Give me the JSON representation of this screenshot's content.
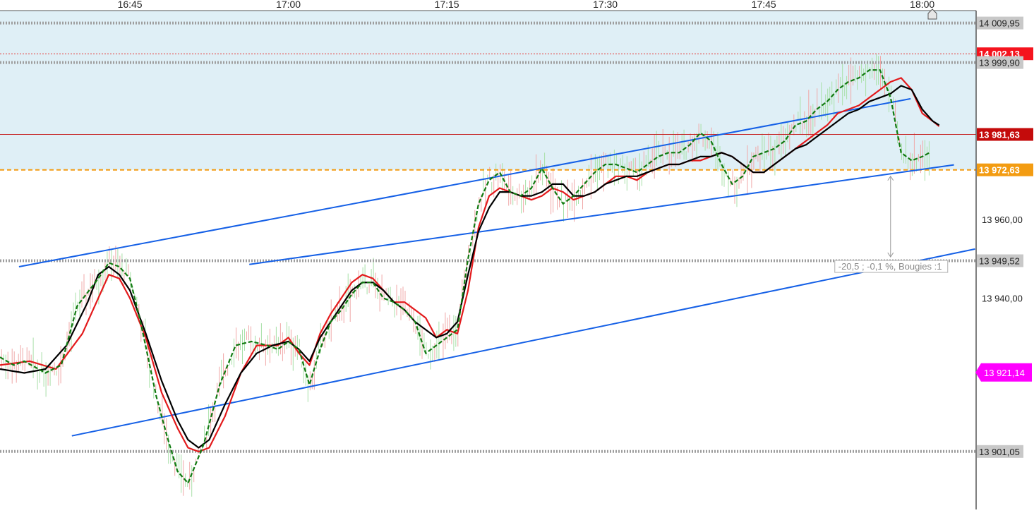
{
  "chart_data": {
    "type": "candlestick",
    "title": "",
    "xaxis": {
      "ticks": [
        "16:45",
        "17:00",
        "17:15",
        "17:30",
        "17:45",
        "18:00"
      ],
      "tick_minutes": [
        0,
        15,
        30,
        45,
        60,
        75
      ],
      "range_minutes": [
        -12.3,
        80.1
      ]
    },
    "yaxis": {
      "ticks": [
        "13 960,00",
        "13 940,00"
      ],
      "tick_values": [
        13960,
        13940
      ],
      "obscured_ticks": [
        13980,
        13920,
        13900
      ],
      "ylim": [
        13886.3,
        14015.8
      ],
      "side": "right"
    },
    "horizontal_levels": [
      {
        "label": "14 009,95",
        "value": 14009.95,
        "style": "dotted",
        "color": "#9e9e9e",
        "badge": "#c8c8c8"
      },
      {
        "label": "14 002,13",
        "value": 14002.13,
        "style": "dotted",
        "color": "#e53935",
        "badge": "#f5141e"
      },
      {
        "label": "13 999,90",
        "value": 13999.9,
        "style": "dotted",
        "color": "#9e9e9e",
        "badge": "#c8c8c8"
      },
      {
        "label": "13 981,63",
        "value": 13981.63,
        "style": "solid",
        "color": "#c62828",
        "badge": "#c40b0b"
      },
      {
        "label": "13 972,63",
        "value": 13972.63,
        "style": "dashed",
        "color": "#f39c12",
        "badge": "#f39c12"
      },
      {
        "label": "13 949,52",
        "value": 13949.52,
        "style": "dotted",
        "color": "#9e9e9e",
        "badge": "#c8c8c8"
      },
      {
        "label": "13 901,05",
        "value": 13901.05,
        "style": "dotted",
        "color": "#9e9e9e",
        "badge": "#c8c8c8"
      }
    ],
    "last_price": {
      "label": "13 921,14",
      "value": 13921.14,
      "color": "#ff00ff"
    },
    "shaded_zone": {
      "from": 13972.63,
      "to": 14015.8,
      "color": "#dfeff6"
    },
    "trendlines": [
      {
        "name": "upper",
        "start": [
          -10.5,
          13948.0
        ],
        "end": [
          73.9,
          13990.7
        ]
      },
      {
        "name": "middle",
        "start": [
          11.3,
          13948.6
        ],
        "end": [
          78.0,
          13973.9
        ]
      },
      {
        "name": "lower",
        "start": [
          -5.5,
          13905.0
        ],
        "end": [
          80.0,
          13952.5
        ]
      }
    ],
    "measure": {
      "label": "-20,5 ; -0,1 %, Bougies :1",
      "x_minutes": 72.0,
      "from": 13971.0,
      "to": 13950.5
    },
    "series": [
      {
        "name": "",
        "color": "#e31a1c",
        "points": [
          [
            -12.3,
            13923
          ],
          [
            -9.5,
            13924
          ],
          [
            -7,
            13922
          ],
          [
            -4.5,
            13931
          ],
          [
            -2,
            13946
          ],
          [
            -1,
            13945
          ],
          [
            0,
            13940
          ],
          [
            1.5,
            13930
          ],
          [
            3,
            13916
          ],
          [
            4.5,
            13907
          ],
          [
            5.5,
            13902
          ],
          [
            6.5,
            13901
          ],
          [
            7.5,
            13902
          ],
          [
            9,
            13910
          ],
          [
            10.5,
            13921
          ],
          [
            12,
            13928
          ],
          [
            14,
            13928
          ],
          [
            15,
            13930
          ],
          [
            16,
            13926
          ],
          [
            17,
            13923
          ],
          [
            18,
            13931
          ],
          [
            19,
            13936
          ],
          [
            20,
            13940
          ],
          [
            21,
            13944
          ],
          [
            22,
            13946
          ],
          [
            23,
            13945
          ],
          [
            24,
            13942
          ],
          [
            25,
            13939
          ],
          [
            26,
            13939
          ],
          [
            27,
            13937
          ],
          [
            28,
            13935
          ],
          [
            29,
            13930
          ],
          [
            30,
            13932
          ],
          [
            31,
            13931
          ],
          [
            32,
            13942
          ],
          [
            33,
            13958
          ],
          [
            34,
            13966
          ],
          [
            35,
            13968
          ],
          [
            36,
            13967
          ],
          [
            37,
            13966
          ],
          [
            38,
            13965
          ],
          [
            39,
            13966
          ],
          [
            40,
            13968
          ],
          [
            41,
            13967
          ],
          [
            42,
            13965
          ],
          [
            43,
            13966
          ],
          [
            44,
            13967
          ],
          [
            45,
            13969
          ],
          [
            46,
            13971
          ],
          [
            47,
            13971
          ],
          [
            48,
            13970
          ],
          [
            49,
            13972
          ],
          [
            50,
            13973
          ],
          [
            51,
            13974
          ],
          [
            52,
            13974
          ],
          [
            53,
            13975
          ],
          [
            54,
            13975
          ],
          [
            55,
            13976
          ],
          [
            56,
            13977
          ],
          [
            57,
            13976
          ],
          [
            58,
            13974
          ],
          [
            59,
            13972
          ],
          [
            60,
            13972
          ],
          [
            61,
            13974
          ],
          [
            62,
            13976
          ],
          [
            63,
            13978
          ],
          [
            64,
            13980
          ],
          [
            65,
            13982
          ],
          [
            66,
            13984
          ],
          [
            67,
            13987
          ],
          [
            68,
            13988
          ],
          [
            69,
            13989
          ],
          [
            70,
            13991
          ],
          [
            71,
            13993
          ],
          [
            72,
            13995
          ],
          [
            73,
            13996
          ],
          [
            74,
            13993
          ],
          [
            75,
            13987
          ],
          [
            76,
            13985
          ],
          [
            76.6,
            13983.7
          ]
        ]
      },
      {
        "name": "",
        "color": "#000000",
        "points": [
          [
            -12.3,
            13922
          ],
          [
            -10,
            13921
          ],
          [
            -8,
            13922
          ],
          [
            -6,
            13928
          ],
          [
            -4,
            13939
          ],
          [
            -3,
            13946
          ],
          [
            -2,
            13948
          ],
          [
            -1,
            13946
          ],
          [
            0,
            13942
          ],
          [
            1.5,
            13931
          ],
          [
            3,
            13919
          ],
          [
            4.5,
            13909
          ],
          [
            5.5,
            13904
          ],
          [
            6.5,
            13902
          ],
          [
            7.5,
            13904
          ],
          [
            9,
            13913
          ],
          [
            10.5,
            13921
          ],
          [
            12,
            13926
          ],
          [
            13.5,
            13928
          ],
          [
            15,
            13929
          ],
          [
            16,
            13927
          ],
          [
            17,
            13924
          ],
          [
            18,
            13930
          ],
          [
            19,
            13934
          ],
          [
            20,
            13938
          ],
          [
            21,
            13942
          ],
          [
            22,
            13944
          ],
          [
            23,
            13944
          ],
          [
            24,
            13942
          ],
          [
            25,
            13939
          ],
          [
            26,
            13937
          ],
          [
            27,
            13934
          ],
          [
            28,
            13932
          ],
          [
            29,
            13930
          ],
          [
            30,
            13931
          ],
          [
            31,
            13934
          ],
          [
            32,
            13946
          ],
          [
            33,
            13957
          ],
          [
            34,
            13963
          ],
          [
            35,
            13967
          ],
          [
            36,
            13967
          ],
          [
            37,
            13966
          ],
          [
            38,
            13966
          ],
          [
            39,
            13967
          ],
          [
            40,
            13969
          ],
          [
            41,
            13969
          ],
          [
            42,
            13966
          ],
          [
            43,
            13966
          ],
          [
            44,
            13967
          ],
          [
            45,
            13969
          ],
          [
            46,
            13970
          ],
          [
            47,
            13971
          ],
          [
            48,
            13971
          ],
          [
            49,
            13972
          ],
          [
            50,
            13973
          ],
          [
            51,
            13974
          ],
          [
            52,
            13974
          ],
          [
            53,
            13975
          ],
          [
            54,
            13976
          ],
          [
            55,
            13976
          ],
          [
            56,
            13977
          ],
          [
            57,
            13976
          ],
          [
            58,
            13974
          ],
          [
            59,
            13972
          ],
          [
            60,
            13972
          ],
          [
            61,
            13974
          ],
          [
            62,
            13976
          ],
          [
            63,
            13978
          ],
          [
            64,
            13979
          ],
          [
            65,
            13981
          ],
          [
            66,
            13983
          ],
          [
            67,
            13985
          ],
          [
            68,
            13987
          ],
          [
            69,
            13988
          ],
          [
            70,
            13990
          ],
          [
            71,
            13991
          ],
          [
            72,
            13992
          ],
          [
            73,
            13994
          ],
          [
            74,
            13993
          ],
          [
            75,
            13988
          ],
          [
            76,
            13985
          ],
          [
            76.6,
            13984
          ]
        ]
      },
      {
        "name": "",
        "color": "#117a11",
        "dashed": true,
        "points": [
          [
            -12.3,
            13925
          ],
          [
            -11,
            13923
          ],
          [
            -10,
            13924
          ],
          [
            -8,
            13921
          ],
          [
            -6.5,
            13923
          ],
          [
            -5,
            13938
          ],
          [
            -3,
            13945
          ],
          [
            -2,
            13949
          ],
          [
            -1,
            13948
          ],
          [
            0,
            13945
          ],
          [
            1,
            13934
          ],
          [
            2.5,
            13915
          ],
          [
            3.5,
            13905
          ],
          [
            4.5,
            13896
          ],
          [
            5.5,
            13893
          ],
          [
            7,
            13903
          ],
          [
            8.5,
            13918
          ],
          [
            10,
            13928
          ],
          [
            11.5,
            13929
          ],
          [
            13,
            13928
          ],
          [
            14,
            13927
          ],
          [
            15,
            13929
          ],
          [
            16,
            13927
          ],
          [
            17,
            13918
          ],
          [
            18,
            13927
          ],
          [
            19,
            13934
          ],
          [
            20,
            13937
          ],
          [
            21,
            13941
          ],
          [
            22,
            13944
          ],
          [
            23,
            13944
          ],
          [
            24,
            13940
          ],
          [
            25,
            13939
          ],
          [
            26,
            13937
          ],
          [
            27,
            13934
          ],
          [
            28,
            13926
          ],
          [
            29,
            13928
          ],
          [
            30,
            13930
          ],
          [
            31,
            13932
          ],
          [
            32,
            13950
          ],
          [
            33,
            13964
          ],
          [
            34,
            13970
          ],
          [
            35,
            13972
          ],
          [
            36,
            13967
          ],
          [
            37,
            13966
          ],
          [
            38,
            13968
          ],
          [
            39,
            13973
          ],
          [
            40,
            13968
          ],
          [
            41,
            13964
          ],
          [
            42,
            13966
          ],
          [
            43,
            13969
          ],
          [
            44,
            13972
          ],
          [
            45,
            13974
          ],
          [
            46,
            13974
          ],
          [
            47,
            13973
          ],
          [
            48,
            13972
          ],
          [
            49,
            13974
          ],
          [
            50,
            13976
          ],
          [
            51,
            13977
          ],
          [
            52,
            13977
          ],
          [
            53,
            13979
          ],
          [
            54,
            13982
          ],
          [
            55,
            13980
          ],
          [
            56,
            13974
          ],
          [
            57,
            13969
          ],
          [
            58,
            13971
          ],
          [
            59,
            13976
          ],
          [
            60,
            13977
          ],
          [
            61,
            13978
          ],
          [
            62,
            13980
          ],
          [
            63,
            13984
          ],
          [
            64,
            13985
          ],
          [
            65,
            13988
          ],
          [
            66,
            13990
          ],
          [
            67,
            13993
          ],
          [
            68,
            13995
          ],
          [
            69,
            13996
          ],
          [
            70,
            13998
          ],
          [
            71,
            13998
          ],
          [
            72,
            13991
          ],
          [
            73,
            13977
          ],
          [
            74,
            13975
          ],
          [
            75,
            13976
          ],
          [
            75.7,
            13977
          ]
        ]
      }
    ]
  }
}
